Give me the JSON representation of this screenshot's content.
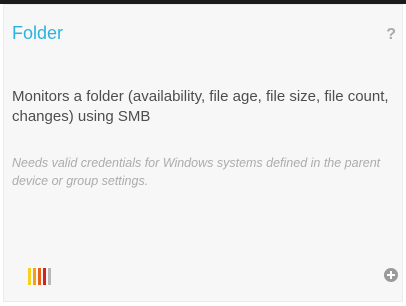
{
  "card": {
    "title": "Folder",
    "help_glyph": "?",
    "description": "Monitors a folder (availability, file age, file size, file count, changes) using SMB",
    "note": "Needs valid credentials for Windows systems defined in the parent device or group settings.",
    "icons": {
      "help": "help-icon",
      "add": "add-circle-icon",
      "priority": "priority-bars-icon"
    },
    "priority_bar_colors": [
      "#f6d21d",
      "#f2a20f",
      "#ea5f1a",
      "#d62121",
      "#b9b9b9"
    ]
  },
  "colors": {
    "title": "#2bb3e0",
    "description": "#4d4d4d",
    "note": "#acacac",
    "icon": "#9a9a9a",
    "card_background": "#f7f7f7"
  }
}
